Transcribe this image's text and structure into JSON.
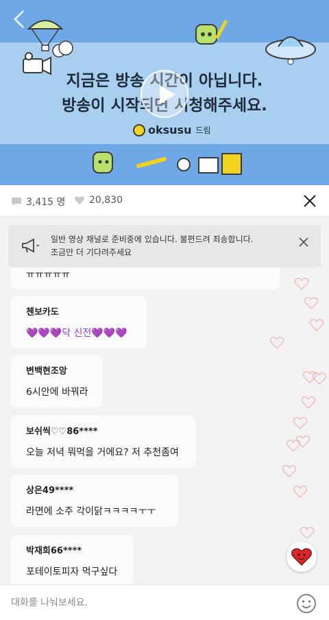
{
  "video": {
    "line1": "지금은 방송 시간이 아닙니다.",
    "line2": "방송이 시작되면 시청해주세요.",
    "brand_name": "oksusu",
    "brand_sub": "드림",
    "colors": {
      "sky": "#6fa8e6",
      "band": "#a9cfef"
    }
  },
  "stats": {
    "comments_count": "3,415 명",
    "likes_count": "20,830"
  },
  "notice": {
    "line1": "일반 영상 채널로 준비중에 있습니다. 불편드려 죄송합니다.",
    "line2": "조금만 더 기다려주세요"
  },
  "chat": {
    "partial_message": "ㅠㅠㅠㅠㅠ",
    "messages": [
      {
        "user": "첸보카도",
        "text": "💜💜💜닥 신전💜💜💜"
      },
      {
        "user": "변백현조앙",
        "text": "6시안에 바꿔라"
      },
      {
        "user": "보쉬씩♡♡86****",
        "text": "오늘 저녁 뭐먹을 거에요? 저 추천좀여"
      },
      {
        "user": "상은49****",
        "text": "라면에 소주 각이닭ㅋㅋㅋㅋㅜㅜ"
      },
      {
        "user": "박재희66****",
        "text": "포테이토피자 먹구싶다"
      }
    ]
  },
  "input": {
    "placeholder": "대화를 나눠보세요."
  }
}
